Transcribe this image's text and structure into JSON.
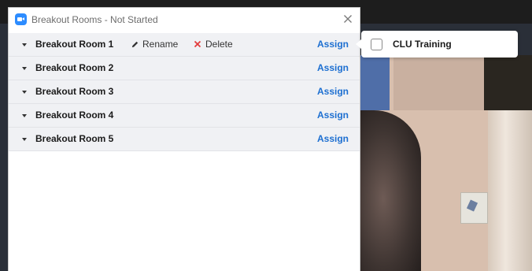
{
  "window": {
    "title": "Breakout Rooms - Not Started"
  },
  "rooms": [
    {
      "name": "Breakout Room 1",
      "rename_label": "Rename",
      "delete_label": "Delete",
      "assign_label": "Assign"
    },
    {
      "name": "Breakout Room 2",
      "assign_label": "Assign"
    },
    {
      "name": "Breakout Room 3",
      "assign_label": "Assign"
    },
    {
      "name": "Breakout Room 4",
      "assign_label": "Assign"
    },
    {
      "name": "Breakout Room 5",
      "assign_label": "Assign"
    }
  ],
  "assign_popover": {
    "participant_name": "CLU Training",
    "checked": false
  },
  "colors": {
    "accent_link": "#1d6fd1",
    "delete_icon": "#e23b3b",
    "app_icon": "#2d8cff",
    "row_background": "#f0f1f4"
  },
  "icons": {
    "app": "zoom-camera-icon",
    "close": "close-icon",
    "expand": "caret-down-icon",
    "rename": "pencil-icon",
    "delete": "x-icon"
  }
}
